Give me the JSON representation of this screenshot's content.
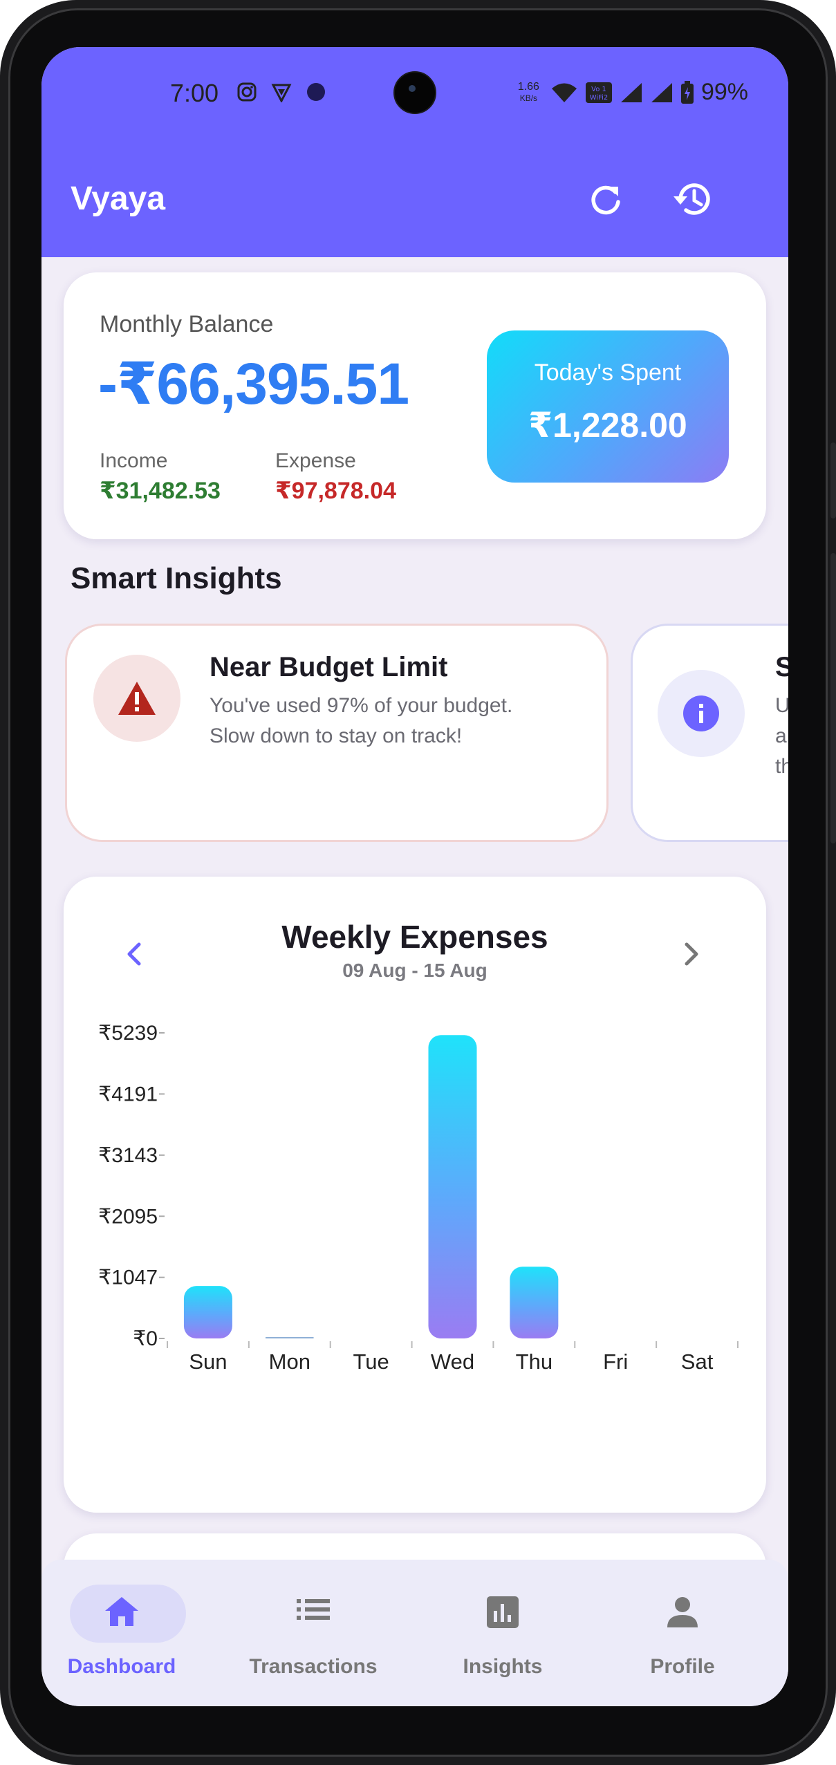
{
  "status_bar": {
    "time": "7:00",
    "net_speed_value": "1.66",
    "net_speed_unit": "KB/s",
    "volte_label": "Vo WiFi2",
    "battery": "99%"
  },
  "app_bar": {
    "title": "Vyaya",
    "refresh_icon": "refresh-icon",
    "history_icon": "history-icon",
    "color": "#6c63ff"
  },
  "balance": {
    "label": "Monthly Balance",
    "amount": "-₹66,395.51",
    "income_label": "Income",
    "income_value": "₹31,482.53",
    "expense_label": "Expense",
    "expense_value": "₹97,878.04",
    "today_label": "Today's Spent",
    "today_value": "₹1,228.00",
    "colors": {
      "balance": "#2f7df3",
      "income": "#2e7d32",
      "expense": "#c62828"
    }
  },
  "insights": {
    "title": "Smart Insights",
    "cards": [
      {
        "icon": "warning-icon",
        "title": "Near Budget Limit",
        "text_line1": "You've used 97% of your budget.",
        "text_line2": "Slow down to stay on track!"
      },
      {
        "icon": "info-icon",
        "title": "S",
        "text_line1": "U",
        "text_line2": "a",
        "text_line3": "th"
      }
    ]
  },
  "weekly": {
    "title": "Weekly Expenses",
    "range": "09 Aug - 15 Aug",
    "prev_icon": "chevron-left-icon",
    "next_icon": "chevron-right-icon"
  },
  "chart_data": {
    "type": "bar",
    "title": "Weekly Expenses",
    "subtitle": "09 Aug - 15 Aug",
    "categories": [
      "Sun",
      "Mon",
      "Tue",
      "Wed",
      "Thu",
      "Fri",
      "Sat"
    ],
    "values": [
      900,
      5,
      0,
      5200,
      1230,
      0,
      0
    ],
    "ytick_labels": [
      "₹0",
      "₹1047",
      "₹2095",
      "₹3143",
      "₹4191",
      "₹5239"
    ],
    "yticks": [
      0,
      1047,
      2095,
      3143,
      4191,
      5239
    ],
    "ylim": [
      0,
      5239
    ],
    "grid": false,
    "xlabel": "",
    "ylabel": ""
  },
  "bottom_nav": {
    "items": [
      {
        "label": "Dashboard",
        "icon": "home-icon",
        "active": true
      },
      {
        "label": "Transactions",
        "icon": "list-icon",
        "active": false
      },
      {
        "label": "Insights",
        "icon": "bar-chart-icon",
        "active": false
      },
      {
        "label": "Profile",
        "icon": "person-icon",
        "active": false
      }
    ]
  }
}
